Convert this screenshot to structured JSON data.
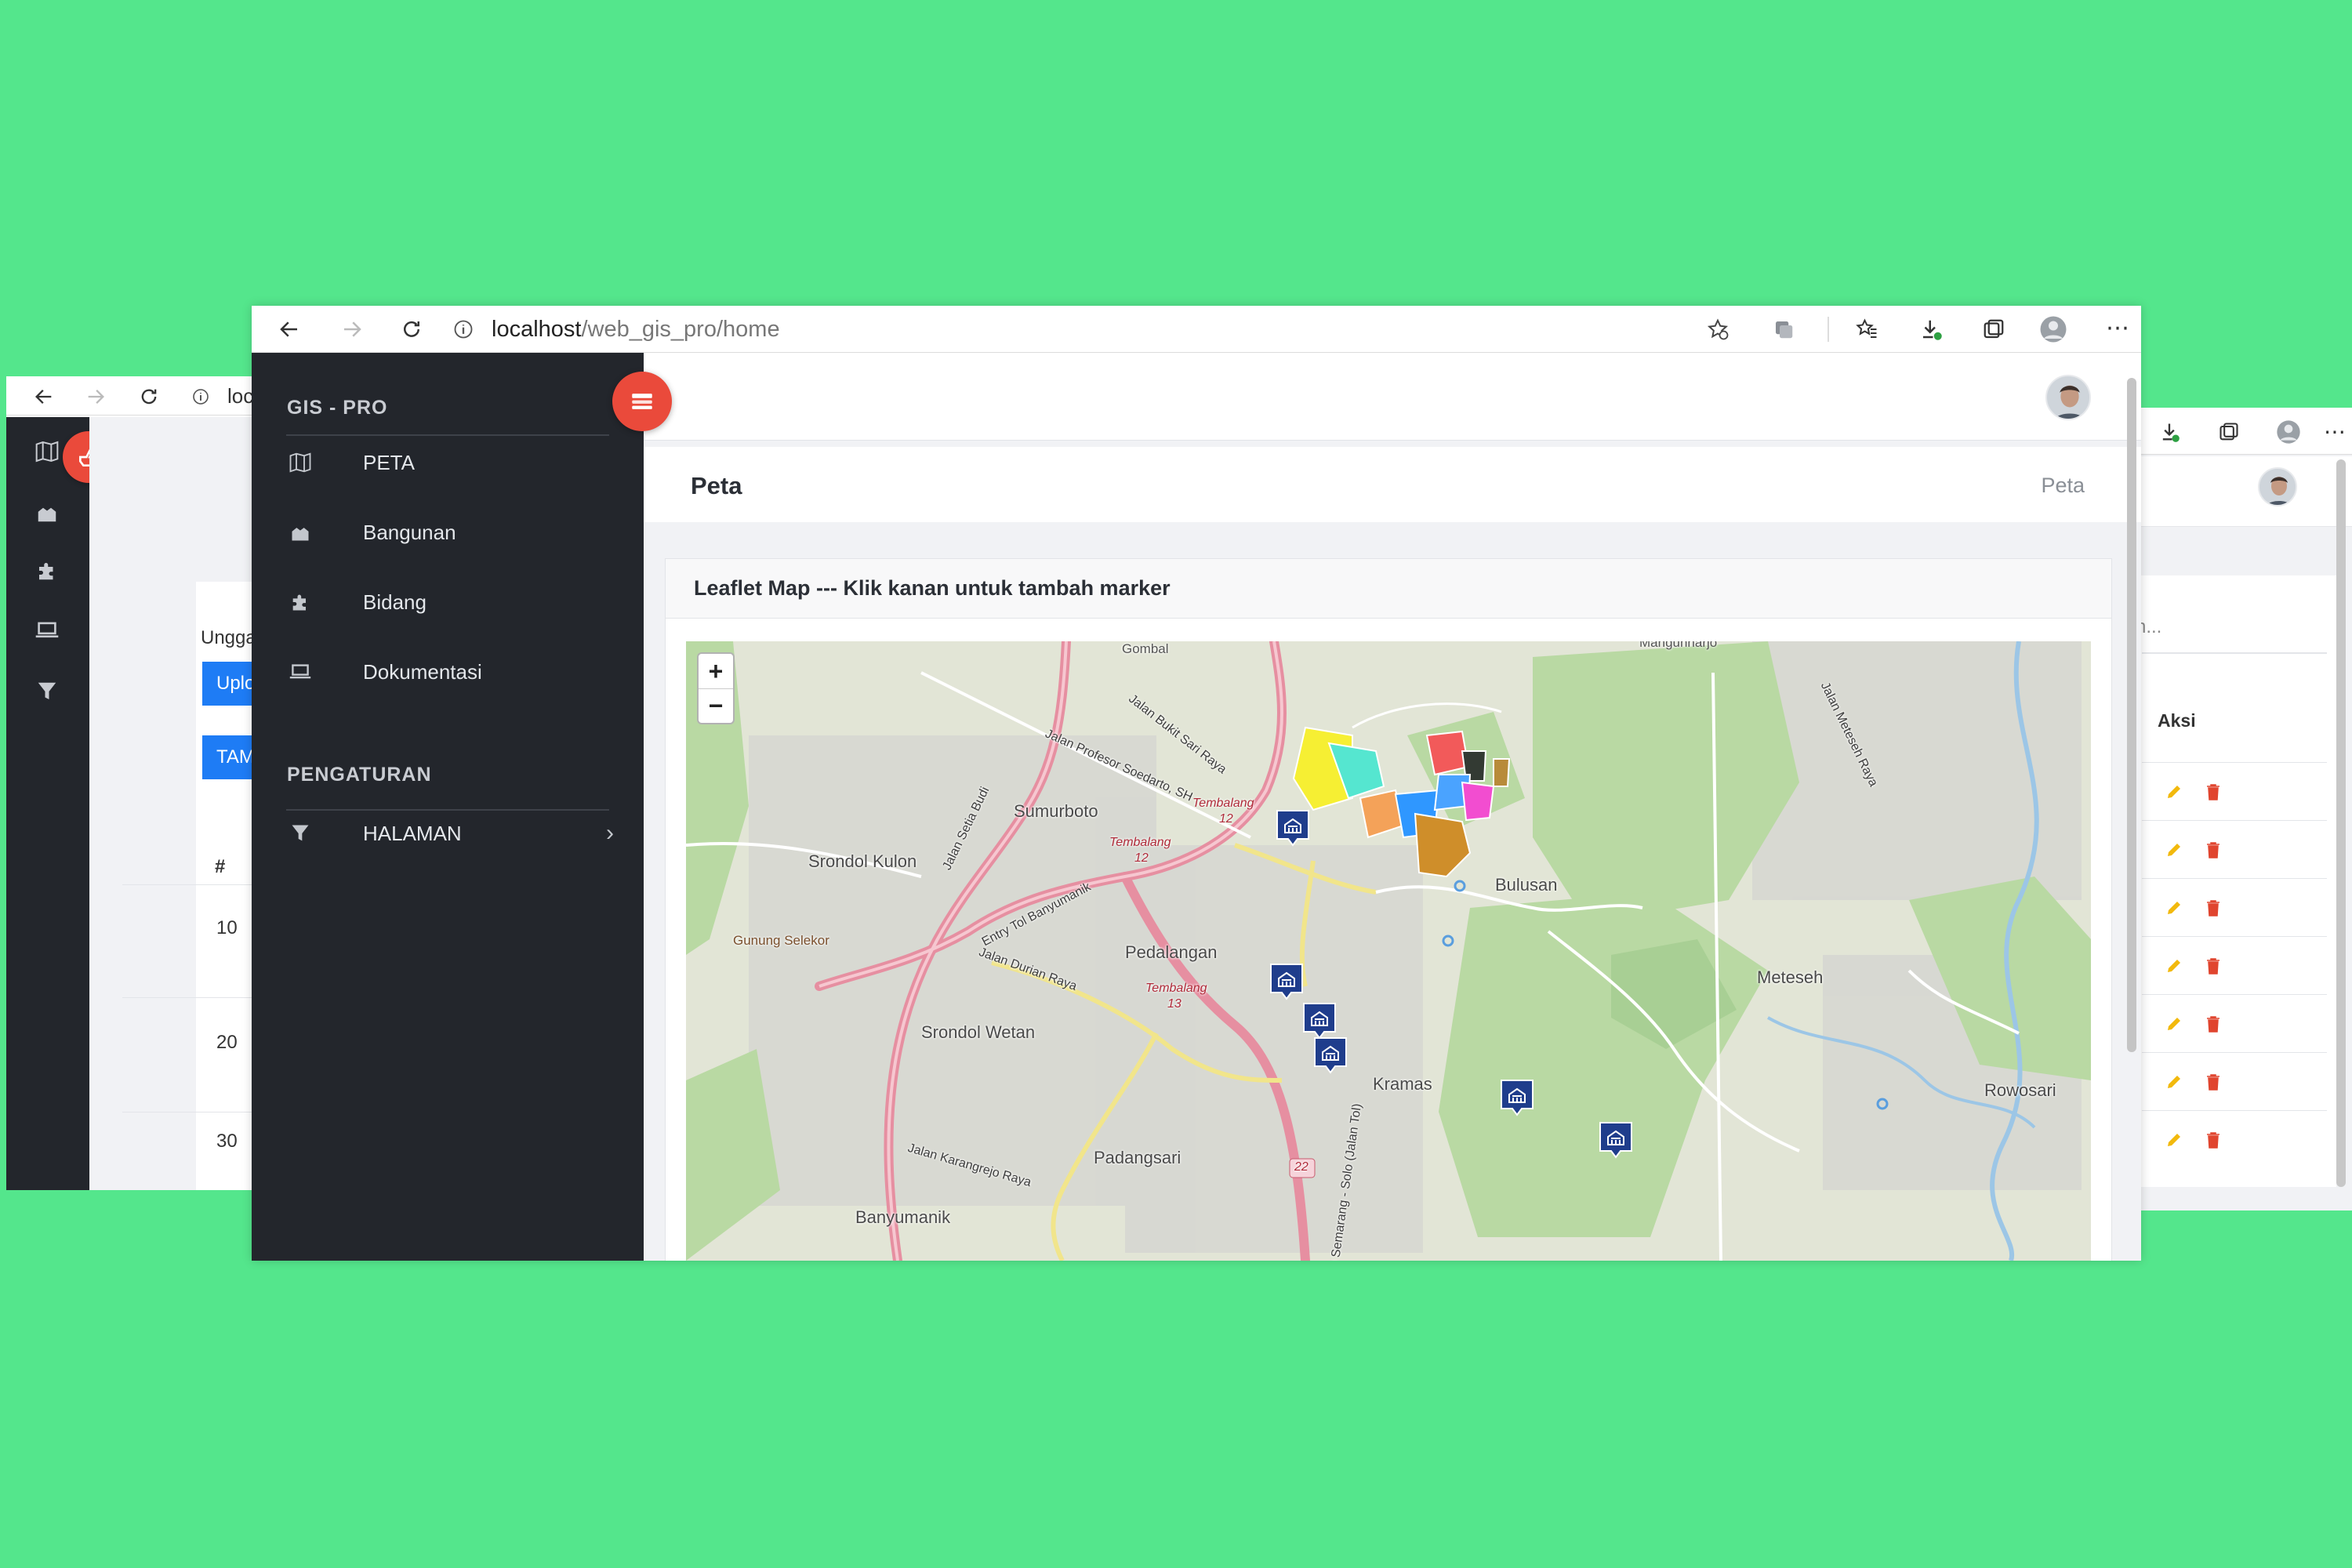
{
  "main_window": {
    "url_host": "localhost",
    "url_path": "/web_gis_pro/home",
    "sidebar": {
      "brand": "GIS - PRO",
      "items": [
        {
          "label": "PETA",
          "icon": "map-icon"
        },
        {
          "label": "Bangunan",
          "icon": "building-icon"
        },
        {
          "label": "Bidang",
          "icon": "puzzle-icon"
        },
        {
          "label": "Dokumentasi",
          "icon": "laptop-icon"
        }
      ],
      "section_title": "PENGATURAN",
      "settings_items": [
        {
          "label": "HALAMAN",
          "icon": "filter-icon"
        }
      ]
    },
    "page_title": "Peta",
    "breadcrumb": "Peta",
    "card_title": "Leaflet Map --- Klik kanan untuk tambah marker",
    "map": {
      "zoom_in": "+",
      "zoom_out": "−",
      "labels": {
        "sumurboto": "Sumurboto",
        "srondol_kulon": "Srondol Kulon",
        "bulusan": "Bulusan",
        "pedalangan": "Pedalangan",
        "meteseh": "Meteseh",
        "srondol_wetan": "Srondol Wetan",
        "kramas": "Kramas",
        "rowosari": "Rowosari",
        "padangsari": "Padangsari",
        "banyumanik": "Banyumanik",
        "gunung_selekor": "Gunung Selekor",
        "gombal": "Gombal",
        "jalan_bukit_sari": "Jalan Bukit Sari Raya",
        "jalan_soedarto": "Jalan Profesor Soedarto, SH",
        "jalan_setia_budi": "Jalan Setia Budi",
        "jalan_durian": "Jalan Durian Raya",
        "jalan_karangrejo": "Jalan Karangrejo Raya",
        "jalan_meteseh": "Jalan Meteseh Raya",
        "entry_tol": "Entry Tol Banyumanik",
        "tembalang": "Tembalang",
        "route_12": "12",
        "route_13": "13",
        "route_22": "22",
        "mangunharjo": "Mangunharjo",
        "jalan_raya": "Raya",
        "semarang_solo": "Jalan Semarang - Solo (Jalan Tol)"
      }
    }
  },
  "left_window": {
    "url_partial": "loc",
    "upload_label": "Ungga",
    "upload_button": "Uplo",
    "add_button": "TAM",
    "col_number": "#",
    "rows": [
      "10",
      "20",
      "30"
    ]
  },
  "right_window": {
    "search_placeholder": "h...",
    "col_action": "Aksi",
    "rows": 7
  },
  "colors": {
    "background": "#54e68c",
    "sidebar": "#23262c",
    "fab": "#ea4a3b",
    "primary_button": "#1e7cf5",
    "edit_icon": "#f2b90d",
    "delete_icon": "#e0452f",
    "marker": "#1f3d8c"
  }
}
